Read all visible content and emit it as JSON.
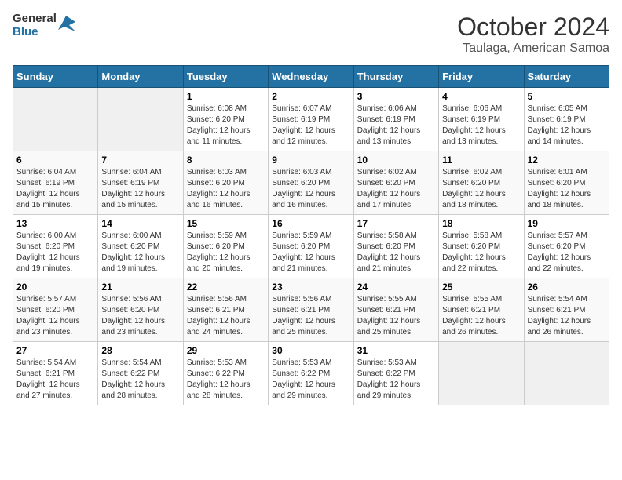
{
  "header": {
    "logo_general": "General",
    "logo_blue": "Blue",
    "title": "October 2024",
    "subtitle": "Taulaga, American Samoa"
  },
  "calendar": {
    "days_of_week": [
      "Sunday",
      "Monday",
      "Tuesday",
      "Wednesday",
      "Thursday",
      "Friday",
      "Saturday"
    ],
    "weeks": [
      [
        {
          "day": null
        },
        {
          "day": null
        },
        {
          "day": "1",
          "sunrise": "6:08 AM",
          "sunset": "6:20 PM",
          "daylight": "12 hours and 11 minutes."
        },
        {
          "day": "2",
          "sunrise": "6:07 AM",
          "sunset": "6:19 PM",
          "daylight": "12 hours and 12 minutes."
        },
        {
          "day": "3",
          "sunrise": "6:06 AM",
          "sunset": "6:19 PM",
          "daylight": "12 hours and 13 minutes."
        },
        {
          "day": "4",
          "sunrise": "6:06 AM",
          "sunset": "6:19 PM",
          "daylight": "12 hours and 13 minutes."
        },
        {
          "day": "5",
          "sunrise": "6:05 AM",
          "sunset": "6:19 PM",
          "daylight": "12 hours and 14 minutes."
        }
      ],
      [
        {
          "day": "6",
          "sunrise": "6:04 AM",
          "sunset": "6:19 PM",
          "daylight": "12 hours and 15 minutes."
        },
        {
          "day": "7",
          "sunrise": "6:04 AM",
          "sunset": "6:19 PM",
          "daylight": "12 hours and 15 minutes."
        },
        {
          "day": "8",
          "sunrise": "6:03 AM",
          "sunset": "6:20 PM",
          "daylight": "12 hours and 16 minutes."
        },
        {
          "day": "9",
          "sunrise": "6:03 AM",
          "sunset": "6:20 PM",
          "daylight": "12 hours and 16 minutes."
        },
        {
          "day": "10",
          "sunrise": "6:02 AM",
          "sunset": "6:20 PM",
          "daylight": "12 hours and 17 minutes."
        },
        {
          "day": "11",
          "sunrise": "6:02 AM",
          "sunset": "6:20 PM",
          "daylight": "12 hours and 18 minutes."
        },
        {
          "day": "12",
          "sunrise": "6:01 AM",
          "sunset": "6:20 PM",
          "daylight": "12 hours and 18 minutes."
        }
      ],
      [
        {
          "day": "13",
          "sunrise": "6:00 AM",
          "sunset": "6:20 PM",
          "daylight": "12 hours and 19 minutes."
        },
        {
          "day": "14",
          "sunrise": "6:00 AM",
          "sunset": "6:20 PM",
          "daylight": "12 hours and 19 minutes."
        },
        {
          "day": "15",
          "sunrise": "5:59 AM",
          "sunset": "6:20 PM",
          "daylight": "12 hours and 20 minutes."
        },
        {
          "day": "16",
          "sunrise": "5:59 AM",
          "sunset": "6:20 PM",
          "daylight": "12 hours and 21 minutes."
        },
        {
          "day": "17",
          "sunrise": "5:58 AM",
          "sunset": "6:20 PM",
          "daylight": "12 hours and 21 minutes."
        },
        {
          "day": "18",
          "sunrise": "5:58 AM",
          "sunset": "6:20 PM",
          "daylight": "12 hours and 22 minutes."
        },
        {
          "day": "19",
          "sunrise": "5:57 AM",
          "sunset": "6:20 PM",
          "daylight": "12 hours and 22 minutes."
        }
      ],
      [
        {
          "day": "20",
          "sunrise": "5:57 AM",
          "sunset": "6:20 PM",
          "daylight": "12 hours and 23 minutes."
        },
        {
          "day": "21",
          "sunrise": "5:56 AM",
          "sunset": "6:20 PM",
          "daylight": "12 hours and 23 minutes."
        },
        {
          "day": "22",
          "sunrise": "5:56 AM",
          "sunset": "6:21 PM",
          "daylight": "12 hours and 24 minutes."
        },
        {
          "day": "23",
          "sunrise": "5:56 AM",
          "sunset": "6:21 PM",
          "daylight": "12 hours and 25 minutes."
        },
        {
          "day": "24",
          "sunrise": "5:55 AM",
          "sunset": "6:21 PM",
          "daylight": "12 hours and 25 minutes."
        },
        {
          "day": "25",
          "sunrise": "5:55 AM",
          "sunset": "6:21 PM",
          "daylight": "12 hours and 26 minutes."
        },
        {
          "day": "26",
          "sunrise": "5:54 AM",
          "sunset": "6:21 PM",
          "daylight": "12 hours and 26 minutes."
        }
      ],
      [
        {
          "day": "27",
          "sunrise": "5:54 AM",
          "sunset": "6:21 PM",
          "daylight": "12 hours and 27 minutes."
        },
        {
          "day": "28",
          "sunrise": "5:54 AM",
          "sunset": "6:22 PM",
          "daylight": "12 hours and 28 minutes."
        },
        {
          "day": "29",
          "sunrise": "5:53 AM",
          "sunset": "6:22 PM",
          "daylight": "12 hours and 28 minutes."
        },
        {
          "day": "30",
          "sunrise": "5:53 AM",
          "sunset": "6:22 PM",
          "daylight": "12 hours and 29 minutes."
        },
        {
          "day": "31",
          "sunrise": "5:53 AM",
          "sunset": "6:22 PM",
          "daylight": "12 hours and 29 minutes."
        },
        {
          "day": null
        },
        {
          "day": null
        }
      ]
    ]
  },
  "labels": {
    "sunrise_prefix": "Sunrise: ",
    "sunset_prefix": "Sunset: ",
    "daylight_prefix": "Daylight: "
  }
}
